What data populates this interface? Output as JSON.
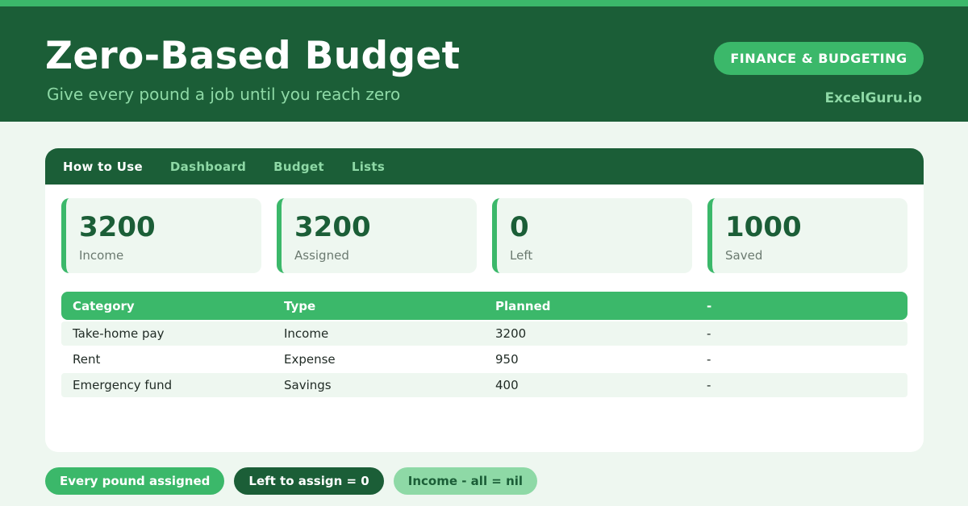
{
  "header": {
    "title": "Zero-Based Budget",
    "subtitle": "Give every pound a job until you reach zero",
    "category_badge": "FINANCE & BUDGETING",
    "brand": "ExcelGuru.io"
  },
  "tabs": [
    {
      "label": "How to Use",
      "active": true
    },
    {
      "label": "Dashboard",
      "active": false
    },
    {
      "label": "Budget",
      "active": false
    },
    {
      "label": "Lists",
      "active": false
    }
  ],
  "stats": [
    {
      "value": "3200",
      "label": "Income"
    },
    {
      "value": "3200",
      "label": "Assigned"
    },
    {
      "value": "0",
      "label": "Left"
    },
    {
      "value": "1000",
      "label": "Saved"
    }
  ],
  "table": {
    "headers": [
      "Category",
      "Type",
      "Planned",
      "-"
    ],
    "rows": [
      [
        "Take-home pay",
        "Income",
        "3200",
        "-"
      ],
      [
        "Rent",
        "Expense",
        "950",
        "-"
      ],
      [
        "Emergency fund",
        "Savings",
        "400",
        "-"
      ]
    ]
  },
  "pills": [
    {
      "label": "Every pound assigned"
    },
    {
      "label": "Left to assign = 0"
    },
    {
      "label": "Income - all = nil"
    }
  ],
  "colors": {
    "accent": "#3bb86a",
    "dark": "#1b5e37",
    "light": "#8ed9a6",
    "background": "#eef7f0"
  }
}
